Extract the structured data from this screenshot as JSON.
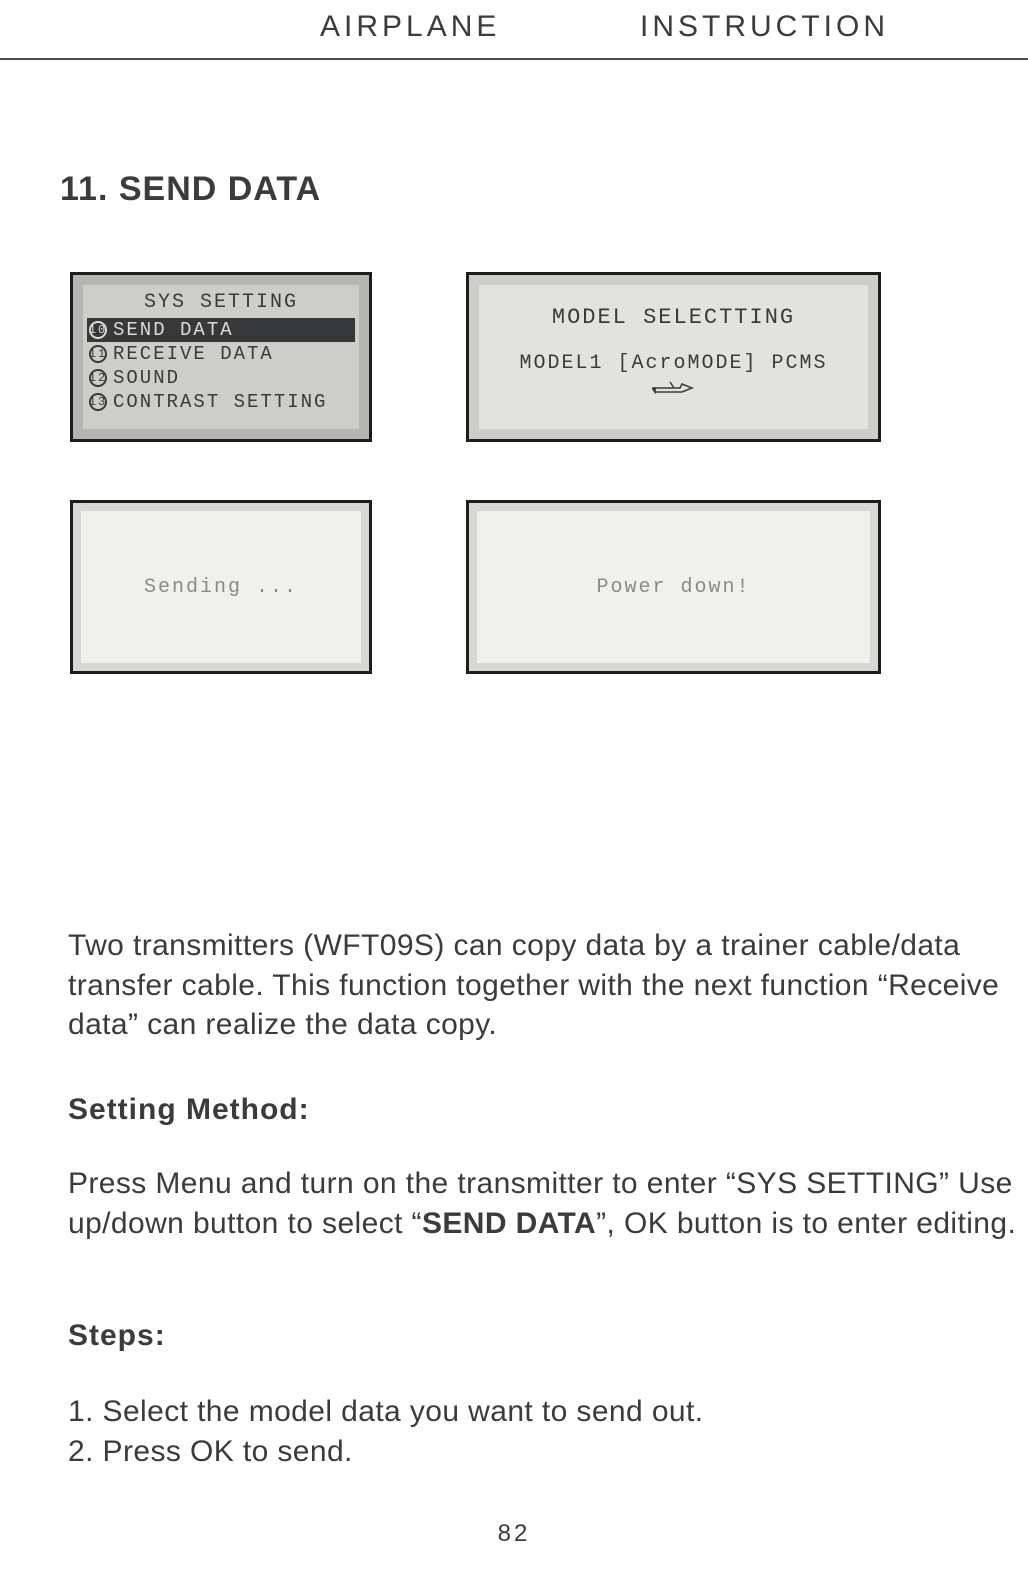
{
  "header": {
    "left": "AIRPLANE",
    "right": "INSTRUCTION"
  },
  "section_title": "11. SEND DATA",
  "lcd1": {
    "title": "SYS SETTING",
    "rows": [
      {
        "num": "10",
        "label": "SEND DATA",
        "selected": true
      },
      {
        "num": "11",
        "label": "RECEIVE DATA",
        "selected": false
      },
      {
        "num": "12",
        "label": "SOUND",
        "selected": false
      },
      {
        "num": "13",
        "label": "CONTRAST SETTING",
        "selected": false
      }
    ]
  },
  "lcd2": {
    "line1": "MODEL SELECTTING",
    "line2": "MODEL1  [AcroMODE] PCMS"
  },
  "lcd3": {
    "text": "Sending ..."
  },
  "lcd4": {
    "text": "Power down!"
  },
  "intro": "Two transmitters (WFT09S) can copy data by a trainer cable/data transfer cable. This function together with the next function “Receive data” can realize the data copy.",
  "method_heading": "Setting Method:",
  "method_pre": "Press Menu and turn on the transmitter to enter “SYS SETTING” Use up/down button to select “",
  "method_bold": "SEND DATA",
  "method_post": "”, OK button is to enter editing.",
  "steps_heading": "Steps:",
  "steps": [
    "1. Select the model data you want to send out.",
    "2. Press OK to send."
  ],
  "page_number": "82"
}
